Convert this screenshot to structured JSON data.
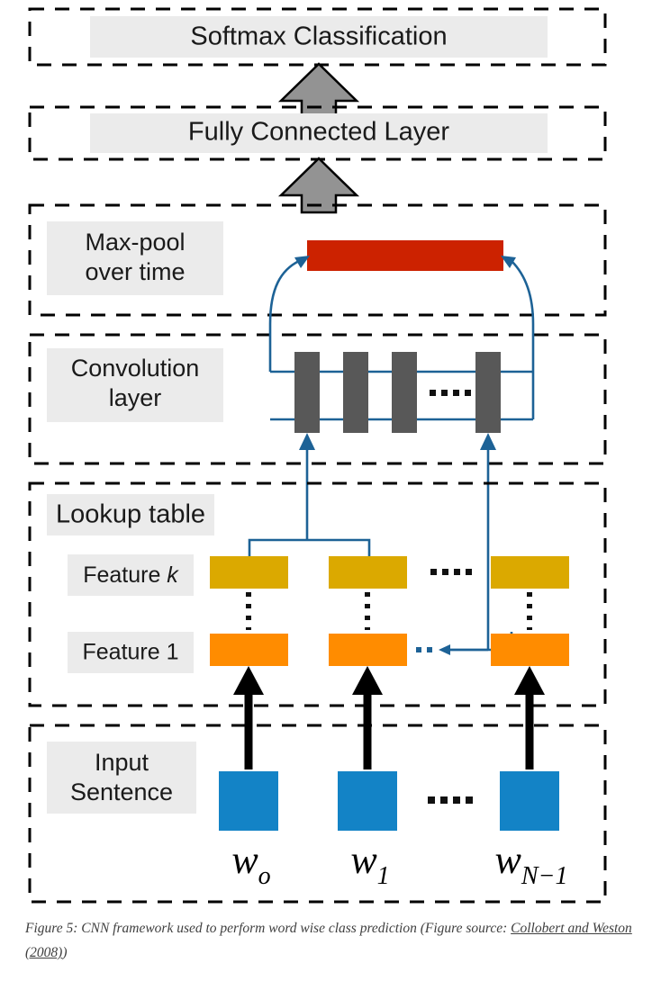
{
  "figure": {
    "regions": [
      {
        "name": "softmax-region",
        "label": "Softmax Classification"
      },
      {
        "name": "fully-connected-region",
        "label": "Fully Connected Layer"
      },
      {
        "name": "maxpool-region",
        "label": "Max-pool\nover time"
      },
      {
        "name": "convolution-region",
        "label": "Convolution\nlayer"
      },
      {
        "name": "lookup-region",
        "label": "Lookup table"
      },
      {
        "name": "input-region",
        "label": "Input\nSentence"
      }
    ],
    "labels": {
      "softmax": "Softmax Classification",
      "fully_connected": "Fully Connected Layer",
      "maxpool_line1": "Max-pool",
      "maxpool_line2": "over time",
      "convolution_line1": "Convolution",
      "convolution_line2": "layer",
      "lookup_table": "Lookup table",
      "feature_k_prefix": "Feature ",
      "feature_k_italic": "k",
      "feature_1": "Feature 1",
      "input_line1": "Input",
      "input_line2": "Sentence"
    },
    "words": [
      {
        "main": "w",
        "sub": "o"
      },
      {
        "main": "w",
        "sub": "1"
      },
      {
        "main": "w",
        "sub": "N−1"
      }
    ],
    "ellipsis_glyph": "....",
    "colors": {
      "pool_bar": "#cc2200",
      "conv_bar": "#585858",
      "feature_k": "#dba900",
      "feature_1": "#ff8c00",
      "word_box": "#1383c6",
      "connector": "#1d6296",
      "chip_bg": "#ebebeb",
      "grey_arrow": "#939393",
      "region_border": "#000000"
    },
    "counts": {
      "conv_bars": 4,
      "feature_columns": 3,
      "word_boxes": 3
    }
  },
  "caption": {
    "text": "Figure 5: CNN framework used to perform word wise class prediction (Figure source: ",
    "link_text": "Collobert and Weston (2008)",
    "tail": ")"
  }
}
